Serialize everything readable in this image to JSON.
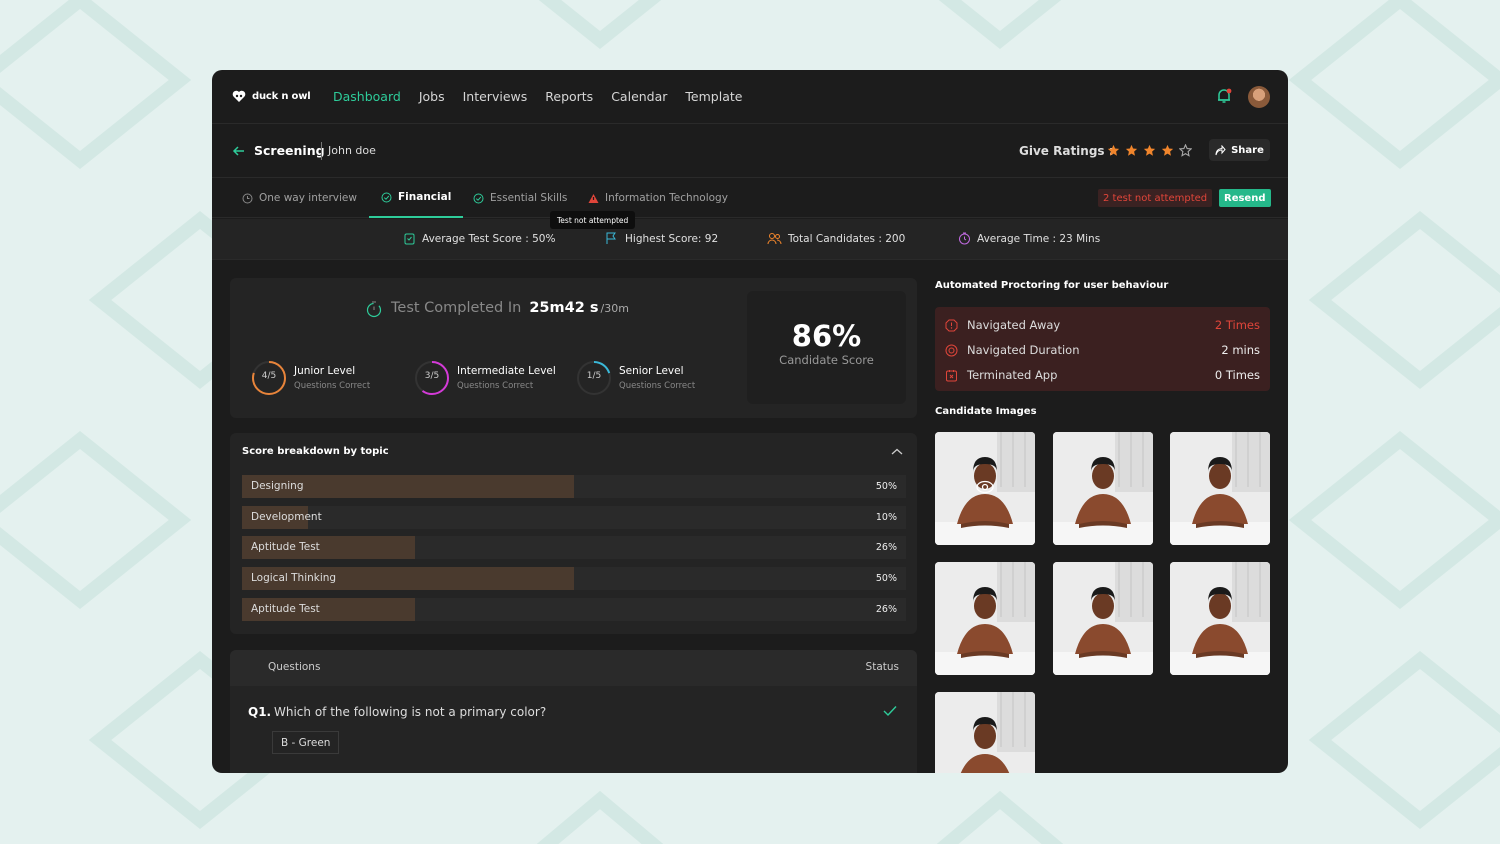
{
  "app": {
    "logo_text": "duck n owl",
    "nav": [
      "Dashboard",
      "Jobs",
      "Interviews",
      "Reports",
      "Calendar",
      "Template"
    ]
  },
  "header": {
    "title": "Screening",
    "candidate": "John doe",
    "ratings_label": "Give Ratings :",
    "rating": 4,
    "rating_max": 5,
    "share_label": "Share"
  },
  "tabs": {
    "items": [
      {
        "label": "One way interview",
        "icon": "clock-icon"
      },
      {
        "label": "Financial",
        "icon": "check-circle-icon",
        "active": true
      },
      {
        "label": "Essential Skills",
        "icon": "check-circle-icon"
      },
      {
        "label": "Information Technology",
        "icon": "warning-icon"
      }
    ],
    "not_attempted": "2 test not attempted",
    "resend": "Resend",
    "tooltip": "Test not attempted"
  },
  "stats": [
    {
      "label": "Average Test Score : 50%",
      "icon": "clipboard-icon"
    },
    {
      "label": "Highest Score: 92",
      "icon": "flag-icon"
    },
    {
      "label": "Total Candidates : 200",
      "icon": "users-icon"
    },
    {
      "label": "Average Time : 23 Mins",
      "icon": "timer-icon"
    }
  ],
  "summary": {
    "completed_label": "Test Completed In",
    "completed_time": "25m42 s",
    "completed_of": "/30m",
    "levels": [
      {
        "fraction": "4/5",
        "name": "Junior Level",
        "sub": "Questions Correct",
        "value": 0.8,
        "color": "#e8843a"
      },
      {
        "fraction": "3/5",
        "name": "Intermediate Level",
        "sub": "Questions Correct",
        "value": 0.6,
        "color": "#d43ad8"
      },
      {
        "fraction": "1/5",
        "name": "Senior Level",
        "sub": "Questions Correct",
        "value": 0.2,
        "color": "#3ab8d8"
      }
    ],
    "score": "86%",
    "score_label": "Candidate Score"
  },
  "breakdown": {
    "title": "Score breakdown by topic",
    "topics": [
      {
        "label": "Designing",
        "pct": "50%",
        "value": 0.5
      },
      {
        "label": "Development",
        "pct": "10%",
        "value": 0.1
      },
      {
        "label": "Aptitude Test",
        "pct": "26%",
        "value": 0.26
      },
      {
        "label": "Logical Thinking",
        "pct": "50%",
        "value": 0.5
      },
      {
        "label": "Aptitude Test",
        "pct": "26%",
        "value": 0.26
      }
    ]
  },
  "questions": {
    "col_question": "Questions",
    "col_status": "Status",
    "items": [
      {
        "num": "Q1.",
        "text": "Which of the following is not a primary color?",
        "answer": "B - Green",
        "status": "correct"
      }
    ]
  },
  "proctoring": {
    "title": "Automated Proctoring for user behaviour",
    "rows": [
      {
        "label": "Navigated Away",
        "value": "2 Times",
        "icon": "alert-icon",
        "highlight": true
      },
      {
        "label": "Navigated Duration",
        "value": "2 mins",
        "icon": "target-icon"
      },
      {
        "label": "Terminated App",
        "value": "0 Times",
        "icon": "app-icon"
      }
    ]
  },
  "images": {
    "title": "Candidate Images",
    "count": 7
  },
  "colors": {
    "accent": "#2ecc9a",
    "star": "#f0852c",
    "danger": "#e0453a"
  }
}
